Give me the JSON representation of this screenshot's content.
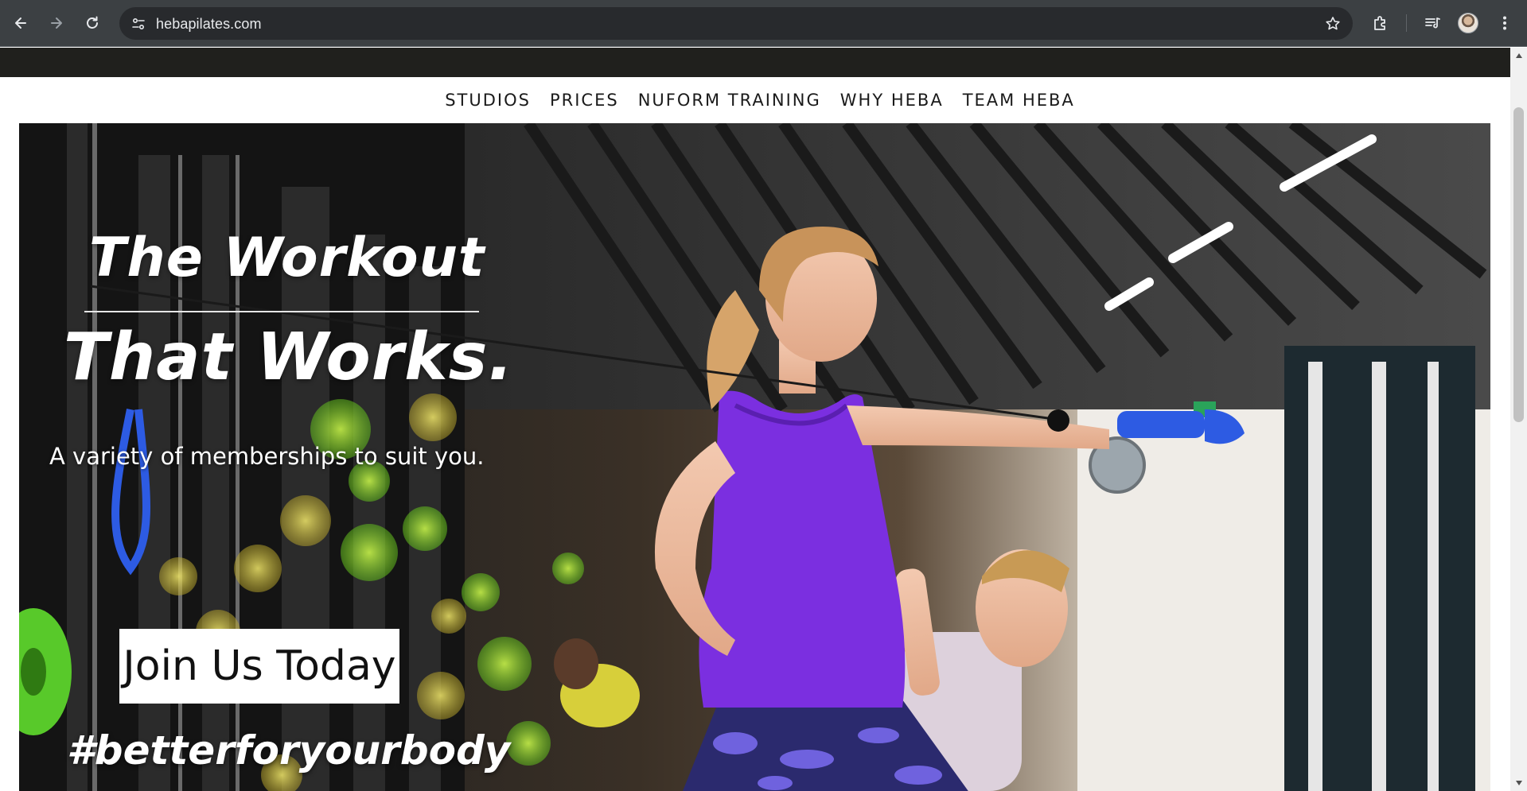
{
  "browser": {
    "url": "hebapilates.com",
    "icons": {
      "back": "back-arrow-icon",
      "forward": "forward-arrow-icon",
      "reload": "reload-icon",
      "site_info": "site-info-icon",
      "bookmark": "star-icon",
      "extensions": "puzzle-icon",
      "media": "media-queue-icon",
      "profile": "avatar",
      "menu": "more-vert-icon"
    }
  },
  "site_nav": {
    "items": [
      {
        "label": "STUDIOS"
      },
      {
        "label": "PRICES"
      },
      {
        "label": "NUFORM TRAINING"
      },
      {
        "label": "WHY HEBA"
      },
      {
        "label": "TEAM HEBA"
      }
    ]
  },
  "hero": {
    "headline_line1": "The Workout",
    "headline_line2": "That Works.",
    "subheading": "A variety of memberships to suit you.",
    "cta_label": "Join Us Today",
    "hashtag": "#betterforyourbody"
  },
  "colors": {
    "top_bar": "#20201d",
    "purple_top": "#7b2fe0",
    "resistance_band": "#2d5be3",
    "bokeh_green": "#9adf2a",
    "bokeh_yellow": "#d8d83a"
  }
}
